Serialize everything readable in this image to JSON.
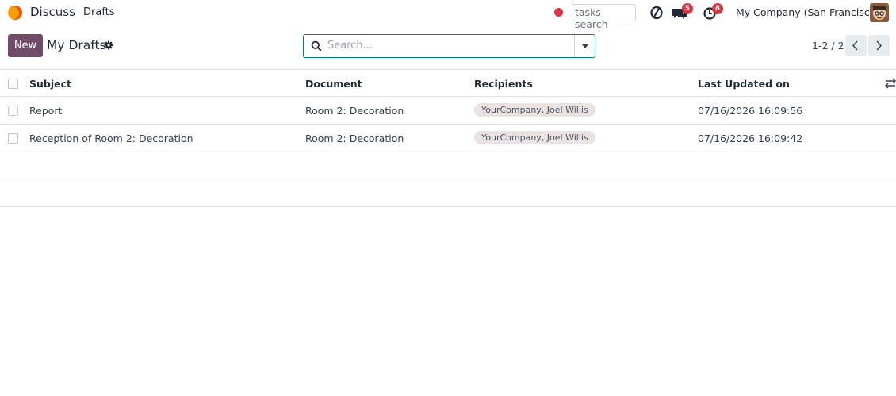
{
  "navbar": {
    "app_name": "Discuss",
    "menu_item": "Drafts",
    "tasks_search": "tasks search",
    "messages_badge": "5",
    "activity_badge": "8",
    "company": "My Company (San Francisco)"
  },
  "control": {
    "new_label": "New",
    "title": "My Drafts",
    "search_placeholder": "Search...",
    "pager": "1-2 / 2"
  },
  "table": {
    "headers": [
      "Subject",
      "Document",
      "Recipients",
      "Last Updated on"
    ],
    "rows": [
      {
        "subject": "Report",
        "document": "Room 2: Decoration",
        "recipients": "YourCompany, Joel Willis",
        "updated": "07/16/2026 16:09:56"
      },
      {
        "subject": "Reception of Room 2: Decoration",
        "document": "Room 2: Decoration",
        "recipients": "YourCompany, Joel Willis",
        "updated": "07/16/2026 16:09:42"
      }
    ]
  },
  "colors": {
    "brand": "#714B67",
    "accent": "#017e84",
    "badge": "#dc3545",
    "tag_bg": "#ebe2e2"
  },
  "icons": [
    "discuss-logo-icon",
    "record-dot-icon",
    "debug-icon",
    "messages-icon",
    "activity-clock-icon",
    "user-avatar",
    "gear-icon",
    "search-icon",
    "caret-down-icon",
    "chevron-left-icon",
    "chevron-right-icon",
    "column-options-icon"
  ]
}
